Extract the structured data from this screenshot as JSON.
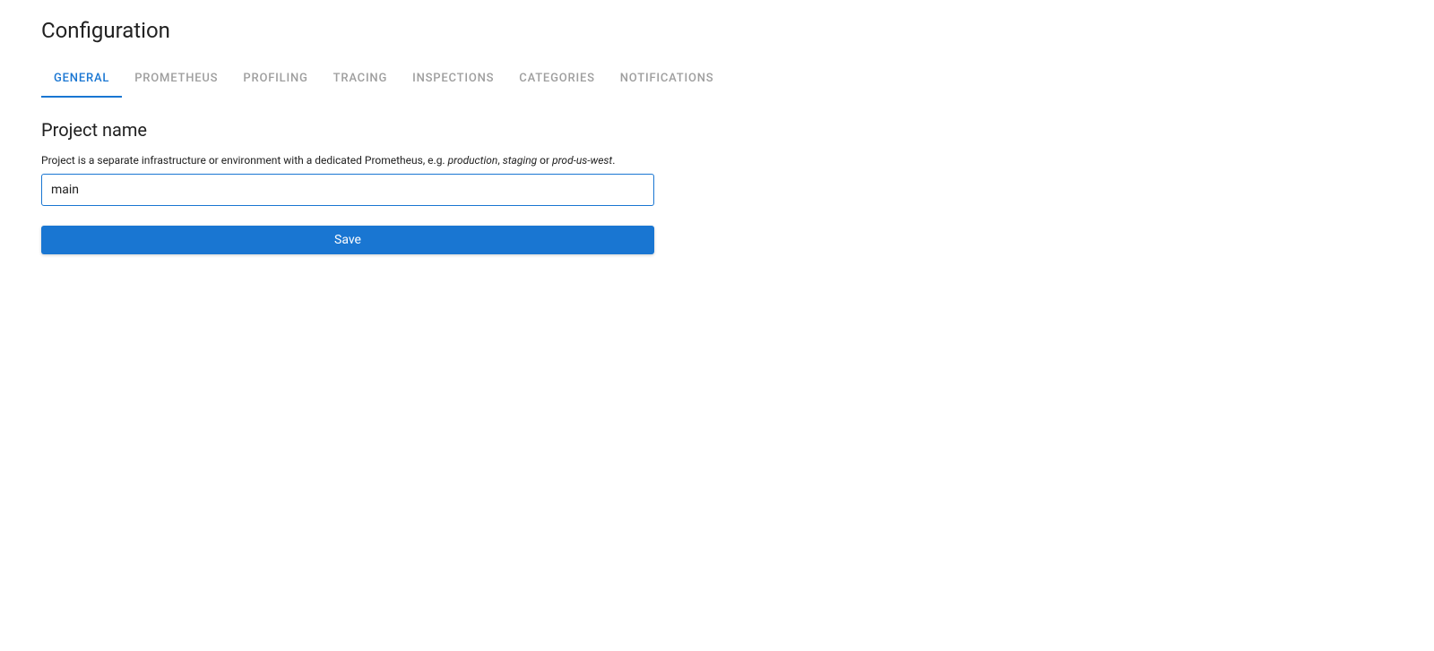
{
  "page": {
    "title": "Configuration"
  },
  "tabs": {
    "items": [
      {
        "label": "GENERAL",
        "active": true
      },
      {
        "label": "PROMETHEUS",
        "active": false
      },
      {
        "label": "PROFILING",
        "active": false
      },
      {
        "label": "TRACING",
        "active": false
      },
      {
        "label": "INSPECTIONS",
        "active": false
      },
      {
        "label": "CATEGORIES",
        "active": false
      },
      {
        "label": "NOTIFICATIONS",
        "active": false
      }
    ]
  },
  "section": {
    "title": "Project name",
    "description_prefix": "Project is a separate infrastructure or environment with a dedicated Prometheus, e.g. ",
    "description_example1": "production",
    "description_sep1": ", ",
    "description_example2": "staging",
    "description_sep2": " or ",
    "description_example3": "prod-us-west",
    "description_suffix": "."
  },
  "form": {
    "project_name_value": "main",
    "save_label": "Save"
  },
  "colors": {
    "primary": "#1976d2",
    "text": "#212121",
    "tab_inactive": "#9e9e9e"
  }
}
